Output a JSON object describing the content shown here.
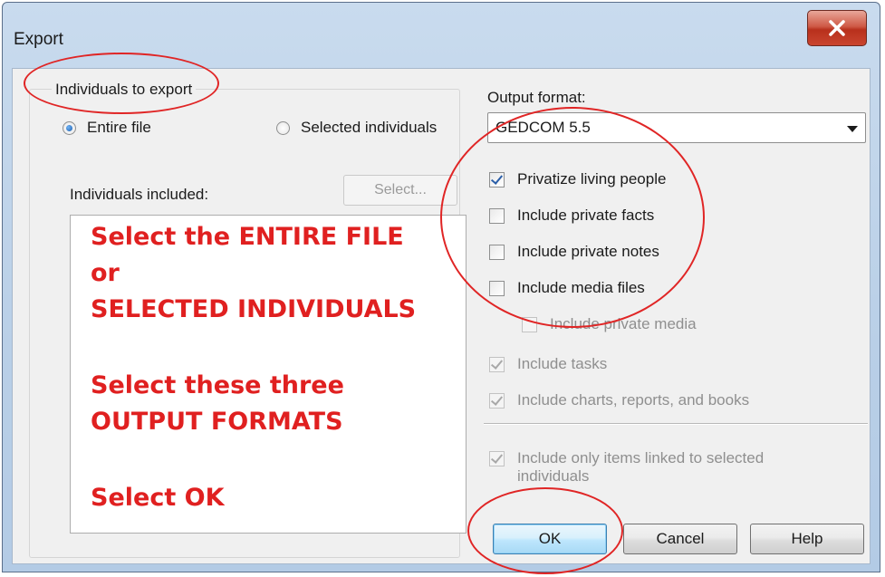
{
  "window": {
    "title": "Export"
  },
  "individuals_group": {
    "legend": "Individuals to export",
    "radio_entire": "Entire file",
    "radio_selected": "Selected individuals",
    "selected_option": "Entire file",
    "included_label": "Individuals included:",
    "select_button": "Select..."
  },
  "annotation": {
    "lines": [
      "Select the ENTIRE FILE",
      "or",
      "SELECTED INDIVIDUALS",
      "Select these three",
      "OUTPUT FORMATS",
      "Select OK"
    ],
    "color": "#e02020"
  },
  "output": {
    "format_label": "Output format:",
    "format_value": "GEDCOM 5.5",
    "options": [
      {
        "label": "Privatize living people",
        "checked": true,
        "enabled": true
      },
      {
        "label": "Include private facts",
        "checked": false,
        "enabled": true
      },
      {
        "label": "Include private notes",
        "checked": false,
        "enabled": true
      },
      {
        "label": "Include media files",
        "checked": false,
        "enabled": true
      },
      {
        "label": "Include private media",
        "checked": false,
        "enabled": false
      },
      {
        "label": "Include tasks",
        "checked": true,
        "enabled": false
      },
      {
        "label": "Include charts, reports, and books",
        "checked": true,
        "enabled": false
      },
      {
        "label": "Include only items linked  to selected individuals",
        "checked": true,
        "enabled": false
      }
    ]
  },
  "buttons": {
    "ok": "OK",
    "cancel": "Cancel",
    "help": "Help"
  },
  "colors": {
    "annotation_red": "#e02020",
    "titlebar": "#c9dbee",
    "close_button": "#c9452f"
  }
}
